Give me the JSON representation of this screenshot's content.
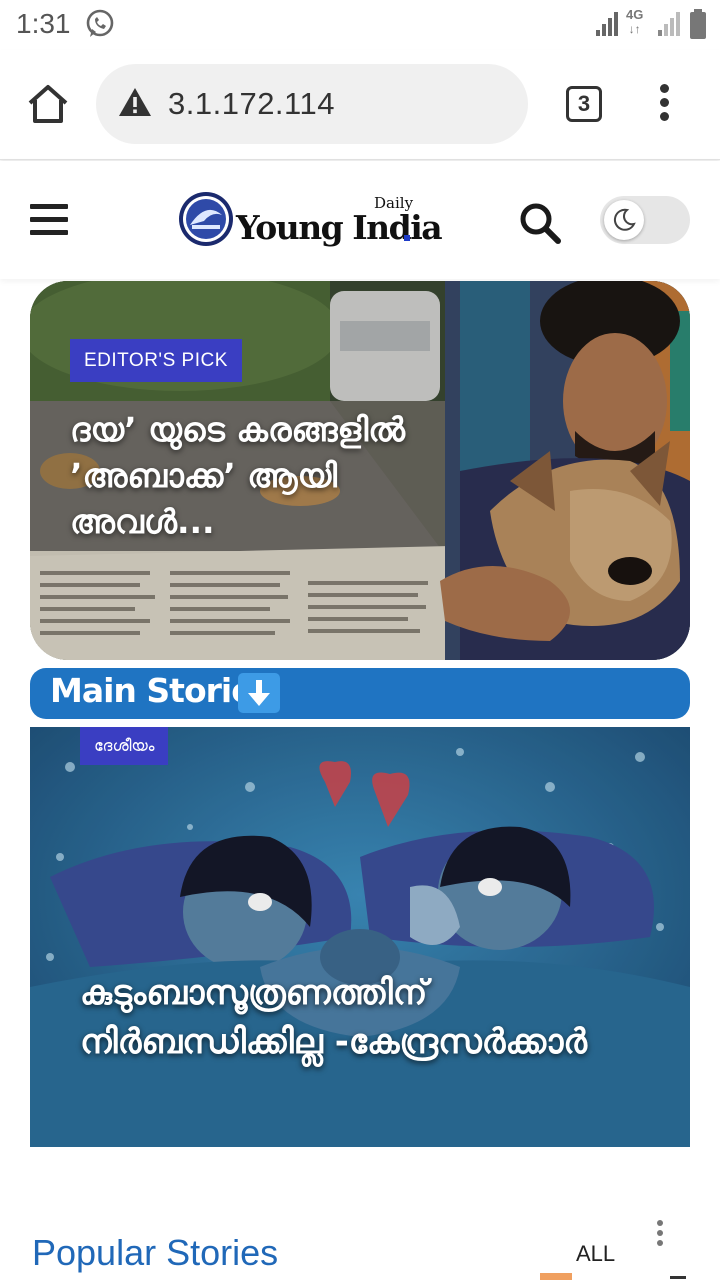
{
  "status_bar": {
    "time": "1:31",
    "network_type": "4G",
    "icons": [
      "whatsapp-icon",
      "signal-icon",
      "signal-icon",
      "battery-icon"
    ]
  },
  "browser": {
    "url": "3.1.172.114",
    "tab_count": "3",
    "icons": [
      "home-icon",
      "warning-icon",
      "tabs-icon",
      "overflow-menu-icon"
    ]
  },
  "site": {
    "logo_daily": "Daily",
    "logo_name": "Young India",
    "icons": [
      "hamburger-menu-icon",
      "search-icon",
      "moon-icon"
    ]
  },
  "editors_pick": {
    "badge": "EDITOR'S PICK",
    "title": "ദയ’ യുടെ കരങ്ങളിൽ ’അബാക്ക’ ആയി അവൾ..."
  },
  "main_stories": {
    "label": "Main Stories",
    "icon": "down-arrow-emoji-icon"
  },
  "main_story": {
    "category": "ദേശീയം",
    "title": "കുടുംബാസൂത്രണത്തിന് നിർബന്ധിക്കില്ല -കേന്ദ്രസർക്കാർ"
  },
  "popular": {
    "heading": "Popular Stories",
    "filter": "ALL"
  }
}
